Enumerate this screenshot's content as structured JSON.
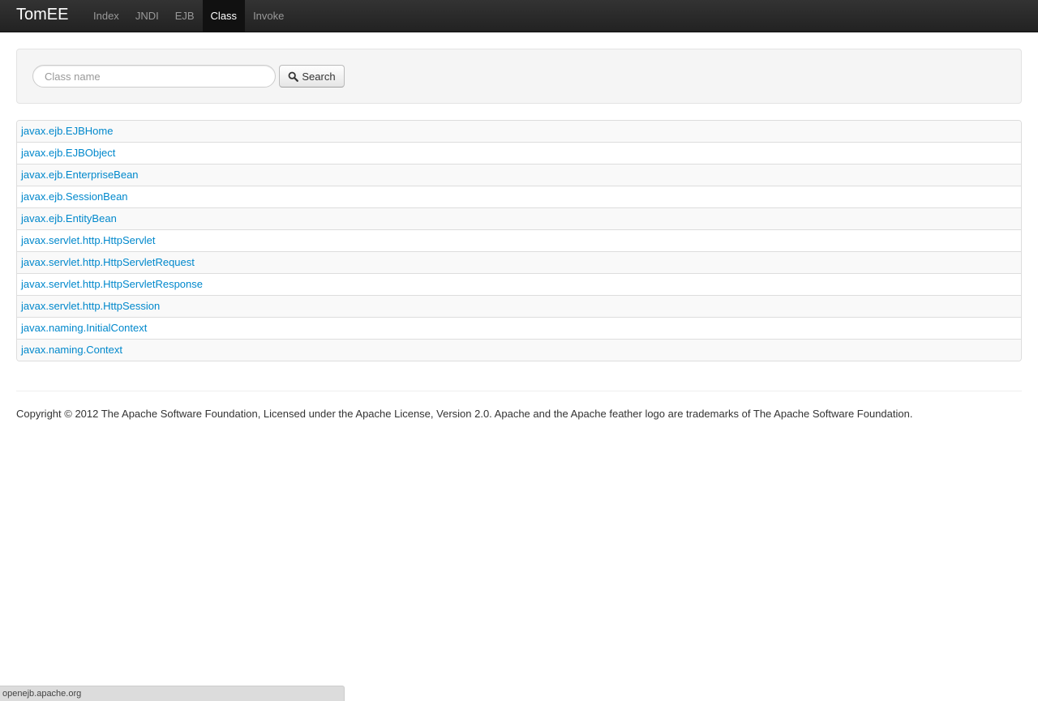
{
  "navbar": {
    "brand": "TomEE",
    "items": [
      {
        "label": "Index",
        "active": false
      },
      {
        "label": "JNDI",
        "active": false
      },
      {
        "label": "EJB",
        "active": false
      },
      {
        "label": "Class",
        "active": true
      },
      {
        "label": "Invoke",
        "active": false
      }
    ]
  },
  "search": {
    "placeholder": "Class name",
    "value": "",
    "button_label": "Search",
    "button_icon": "search-icon"
  },
  "classes": [
    "javax.ejb.EJBHome",
    "javax.ejb.EJBObject",
    "javax.ejb.EnterpriseBean",
    "javax.ejb.SessionBean",
    "javax.ejb.EntityBean",
    "javax.servlet.http.HttpServlet",
    "javax.servlet.http.HttpServletRequest",
    "javax.servlet.http.HttpServletResponse",
    "javax.servlet.http.HttpSession",
    "javax.naming.InitialContext",
    "javax.naming.Context"
  ],
  "footer": {
    "text": "Copyright © 2012 The Apache Software Foundation, Licensed under the Apache License, Version 2.0. Apache and the Apache feather logo are trademarks of The Apache Software Foundation."
  },
  "status_bar": {
    "url": "openejb.apache.org"
  },
  "colors": {
    "navbar_bg": "#222222",
    "link": "#0088cc",
    "active_nav_bg": "#111111"
  }
}
